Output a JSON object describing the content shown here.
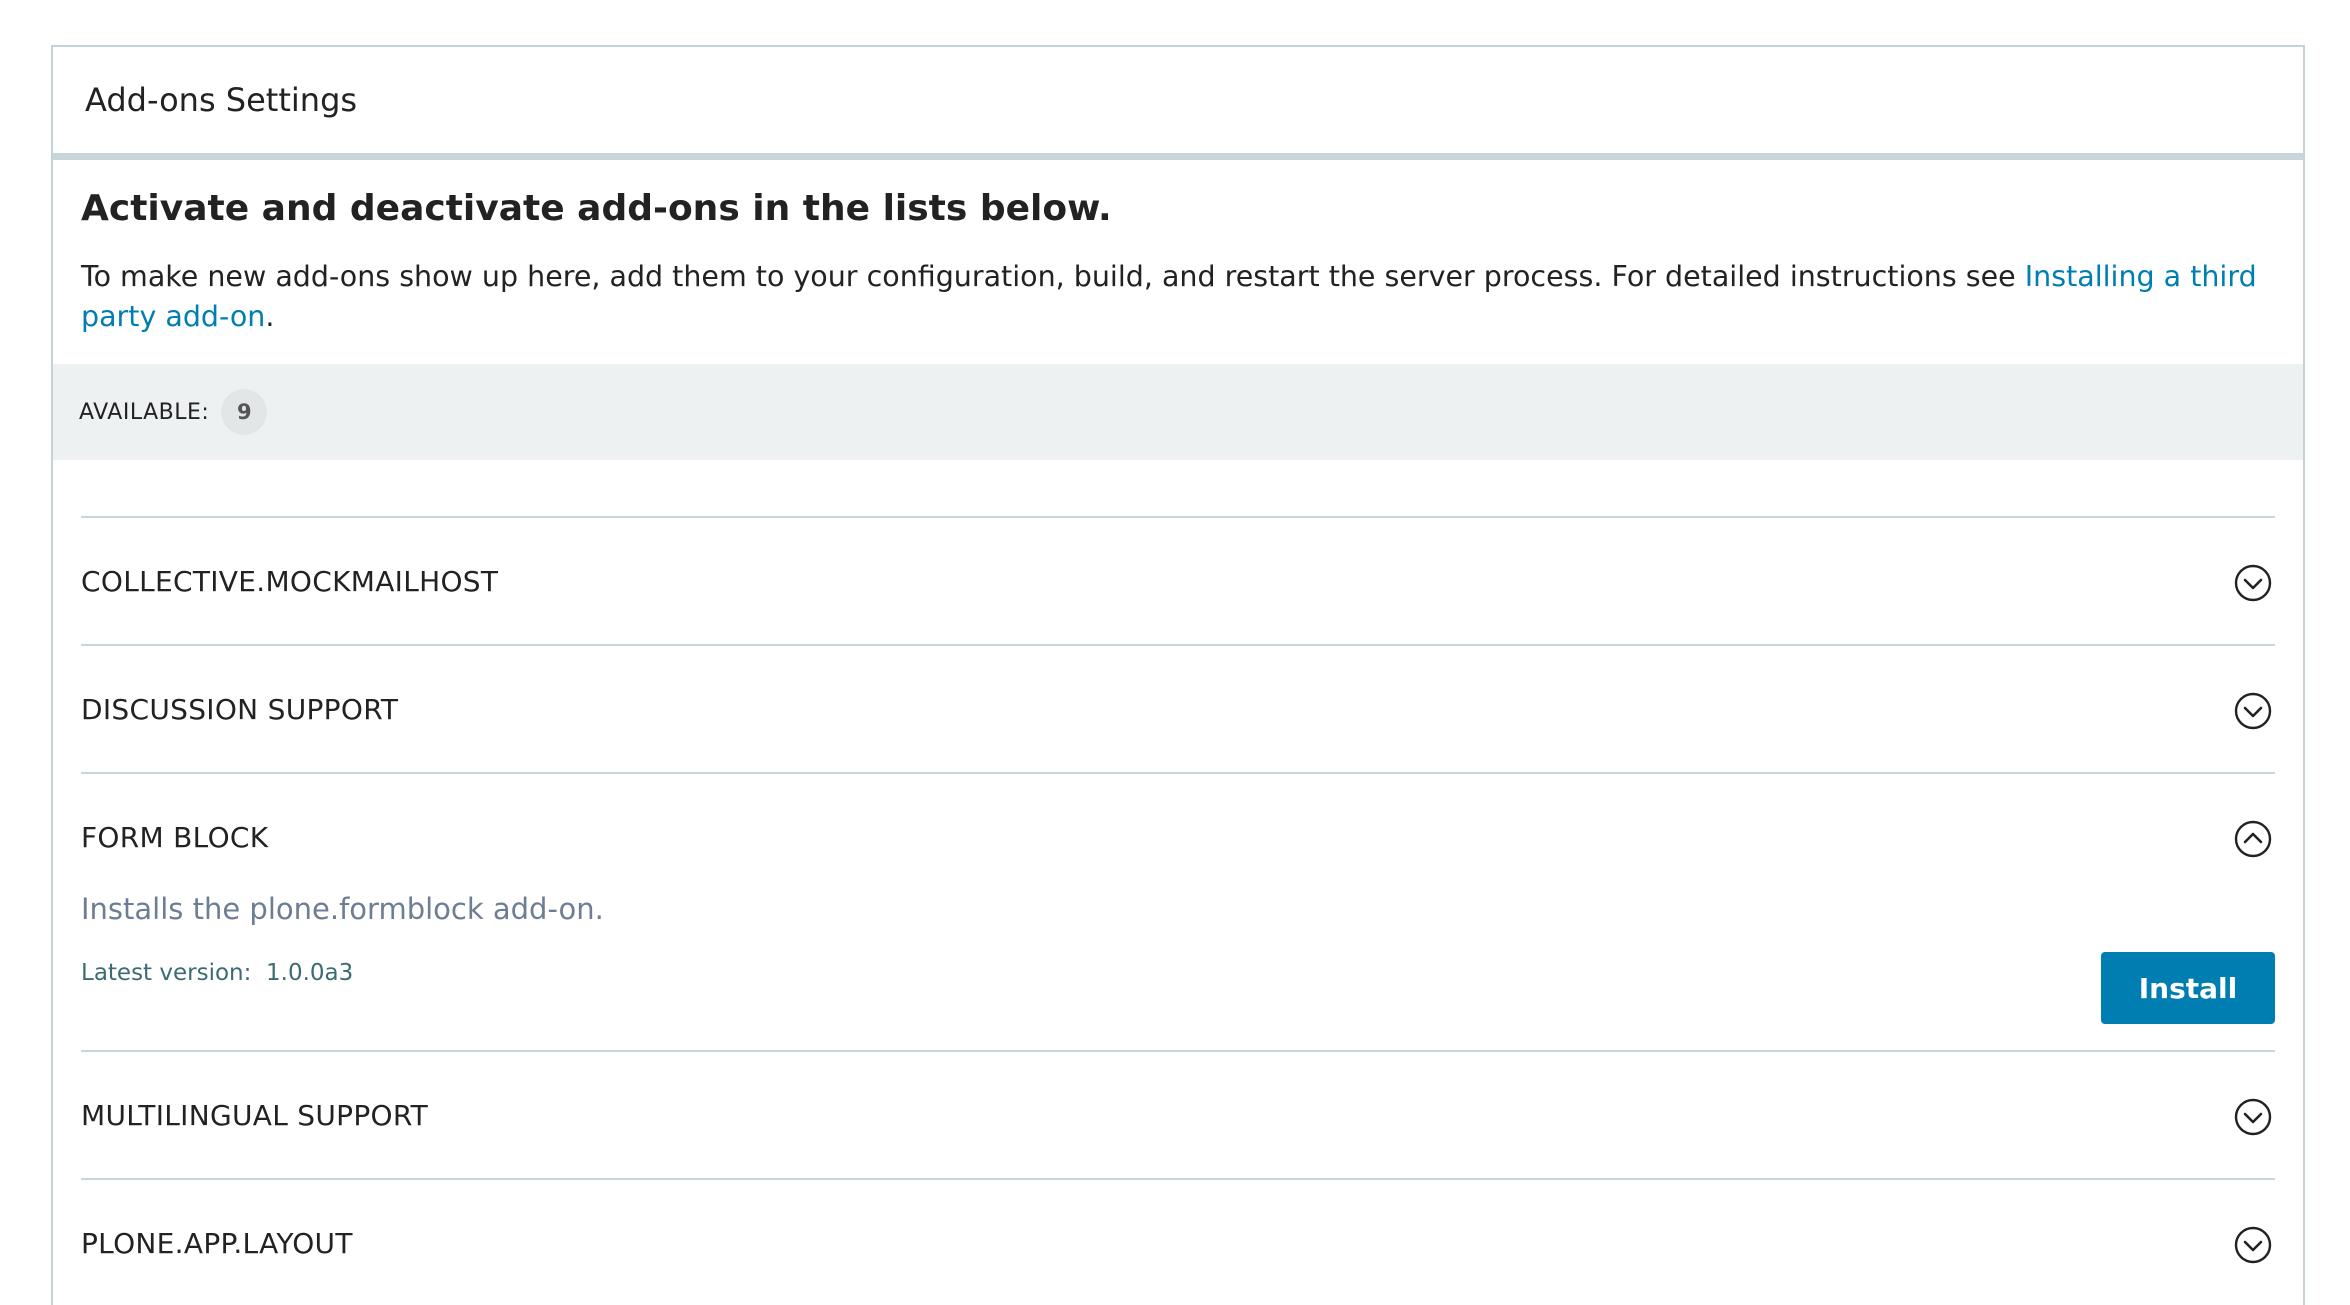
{
  "panel": {
    "title": "Add-ons Settings"
  },
  "intro": {
    "heading": "Activate and deactivate add-ons in the lists below.",
    "text": "To make new add-ons show up here, add them to your configuration, build, and restart the server process. For detailed instructions see ",
    "link_text": "Installing a third party add-on",
    "text_end": "."
  },
  "available": {
    "label": "AVAILABLE:",
    "count": "9"
  },
  "addons": [
    {
      "title": "COLLECTIVE.MOCKMAILHOST",
      "expanded": false,
      "icon": "chevron-down-circle-icon"
    },
    {
      "title": "DISCUSSION SUPPORT",
      "expanded": false,
      "icon": "chevron-down-circle-icon"
    },
    {
      "title": "FORM BLOCK",
      "expanded": true,
      "icon": "chevron-up-circle-icon",
      "description": "Installs the plone.formblock add-on.",
      "version_label": "Latest version:  1.0.0a3",
      "install_label": "Install"
    },
    {
      "title": "MULTILINGUAL SUPPORT",
      "expanded": false,
      "icon": "chevron-down-circle-icon"
    },
    {
      "title": "PLONE.APP.LAYOUT",
      "expanded": false,
      "icon": "chevron-down-circle-icon"
    }
  ],
  "colors": {
    "accent": "#007eb1",
    "border": "#c7d6db",
    "bar_bg": "#edf1f2"
  }
}
